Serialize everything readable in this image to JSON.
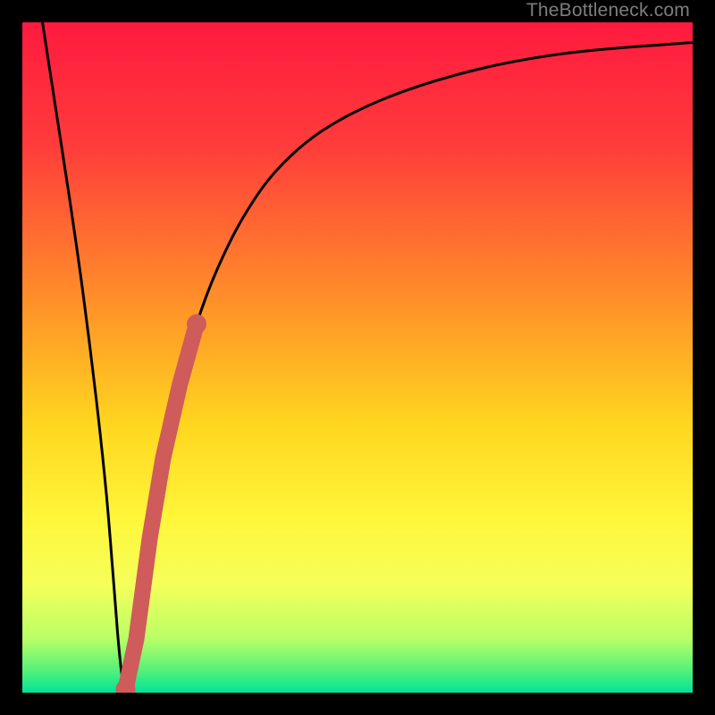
{
  "watermark": "TheBottleneck.com",
  "colors": {
    "frame": "#000000",
    "curve": "#000000",
    "marker": "#cf5b5b",
    "gradient_stops": [
      {
        "pct": 0,
        "color": "#ff1a3f"
      },
      {
        "pct": 18,
        "color": "#ff3b3b"
      },
      {
        "pct": 40,
        "color": "#ff8a2a"
      },
      {
        "pct": 60,
        "color": "#ffd61f"
      },
      {
        "pct": 74,
        "color": "#fff63a"
      },
      {
        "pct": 84,
        "color": "#f5ff5a"
      },
      {
        "pct": 92,
        "color": "#b9ff66"
      },
      {
        "pct": 97,
        "color": "#4cf07a"
      },
      {
        "pct": 100,
        "color": "#00e39a"
      }
    ]
  },
  "chart_data": {
    "type": "line",
    "title": "",
    "xlabel": "",
    "ylabel": "",
    "xlim": [
      0,
      100
    ],
    "ylim": [
      0,
      100
    ],
    "grid": false,
    "series": [
      {
        "name": "bottleneck-curve",
        "x": [
          3,
          5,
          7,
          9,
          11,
          12.5,
          13.5,
          14.2,
          14.8,
          15.4,
          16.2,
          17.5,
          19,
          21,
          23.5,
          26,
          29,
          33,
          38,
          45,
          55,
          68,
          82,
          100
        ],
        "y": [
          100,
          87,
          74,
          60,
          44,
          30,
          18,
          9,
          3,
          0.5,
          3,
          12,
          23,
          35,
          46,
          55,
          63,
          71,
          78,
          84,
          89,
          93,
          95.5,
          97
        ]
      }
    ],
    "markers": [
      {
        "name": "highlight-segment",
        "shape": "round-stroke",
        "x": [
          15.4,
          17.0,
          19.0,
          21.0,
          23.5,
          26.0
        ],
        "y": [
          0.5,
          8,
          23,
          35,
          46,
          55
        ]
      }
    ]
  }
}
